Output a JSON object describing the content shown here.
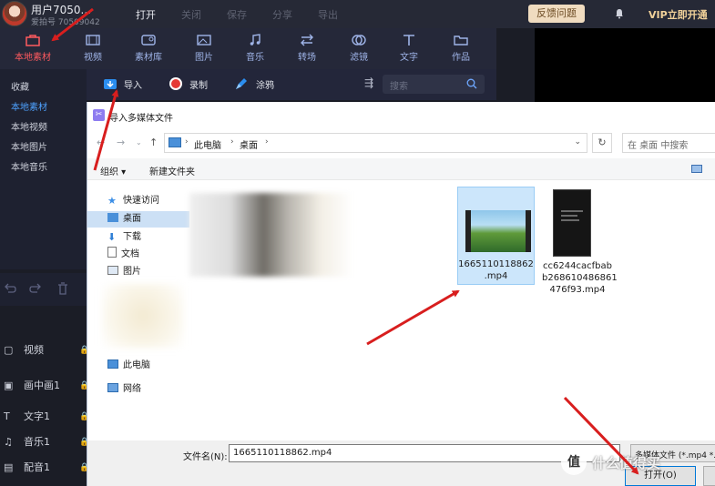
{
  "user": {
    "name": "用户7050...",
    "id": "爱拍号 70509042"
  },
  "top_menu": [
    {
      "label": "打开",
      "state": "active"
    },
    {
      "label": "关闭",
      "state": "dim"
    },
    {
      "label": "保存",
      "state": "dim"
    },
    {
      "label": "分享",
      "state": "dim"
    },
    {
      "label": "导出",
      "state": "dim"
    }
  ],
  "feedback_label": "反馈问题",
  "vip_label": "VIP立即开通",
  "toolbar": [
    {
      "label": "本地素材",
      "icon": "local-assets-icon",
      "active": true
    },
    {
      "label": "视频",
      "icon": "film-icon",
      "active": false
    },
    {
      "label": "素材库",
      "icon": "library-icon",
      "active": false
    },
    {
      "label": "图片",
      "icon": "image-icon",
      "active": false
    },
    {
      "label": "音乐",
      "icon": "music-icon",
      "active": false
    },
    {
      "label": "转场",
      "icon": "transition-icon",
      "active": false
    },
    {
      "label": "滤镜",
      "icon": "filter-icon",
      "active": false
    },
    {
      "label": "文字",
      "icon": "text-icon",
      "active": false
    },
    {
      "label": "作品",
      "icon": "folder-icon",
      "active": false
    }
  ],
  "left_nav": [
    {
      "label": "收藏",
      "active": false
    },
    {
      "label": "本地素材",
      "active": true
    },
    {
      "label": "本地视频",
      "active": false
    },
    {
      "label": "本地图片",
      "active": false
    },
    {
      "label": "本地音乐",
      "active": false
    }
  ],
  "subbar": {
    "import": "导入",
    "record": "录制",
    "paint": "涂鸦",
    "search_placeholder": "搜索"
  },
  "tracks": [
    {
      "label": "视频",
      "icon": "▢"
    },
    {
      "label": "画中画1",
      "icon": "▣"
    },
    {
      "label": "文字1",
      "icon": "T"
    },
    {
      "label": "音乐1",
      "icon": "♫"
    },
    {
      "label": "配音1",
      "icon": "▤"
    }
  ],
  "dialog": {
    "title": "导入多媒体文件",
    "breadcrumb": [
      "此电脑",
      "桌面"
    ],
    "search_placeholder": "在 桌面 中搜索",
    "commands": {
      "organize": "组织 ▾",
      "new_folder": "新建文件夹"
    },
    "sidebar": [
      {
        "label": "快速访问",
        "icon": "star-icon"
      },
      {
        "label": "桌面",
        "icon": "desktop-icon",
        "selected": true
      },
      {
        "label": "下载",
        "icon": "download-icon"
      },
      {
        "label": "文档",
        "icon": "document-icon"
      },
      {
        "label": "图片",
        "icon": "pictures-icon"
      },
      {
        "label": "此电脑",
        "icon": "computer-icon"
      },
      {
        "label": "网络",
        "icon": "network-icon"
      }
    ],
    "files": [
      {
        "name_lines": [
          "1665110118862",
          ".mp4"
        ],
        "selected": true
      },
      {
        "name_lines": [
          "cc6244cacfbab",
          "b268610486861",
          "476f93.mp4"
        ],
        "selected": false
      }
    ],
    "filename_label": "文件名(N):",
    "filename_value": "1665110118862.mp4",
    "filter_value": "多媒体文件 (*.mp4 *.",
    "open_label": "打开(O)"
  },
  "watermark": {
    "logo": "值",
    "text": "什么值得买"
  },
  "colors": {
    "accent_red": "#ff5a5f",
    "link_blue": "#4ea2ff",
    "arrow_red": "#d81e1e",
    "dialog_select": "#cce6fb"
  }
}
